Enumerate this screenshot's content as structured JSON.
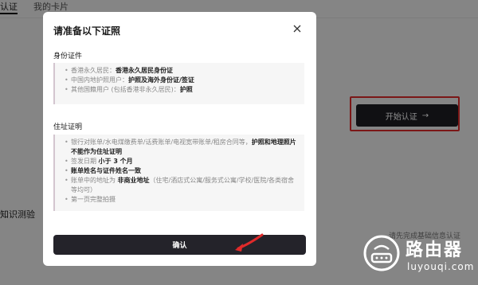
{
  "background": {
    "tabs": [
      {
        "label": "认证"
      },
      {
        "label": "我的卡片"
      }
    ],
    "start_button": {
      "label": "开始认证",
      "icon": "arrow-right-icon"
    },
    "quiz_title": "知识测验",
    "hint": "请先完成基础信息认证"
  },
  "modal": {
    "title": "请准备以下证照",
    "close_icon": "close-icon",
    "identity": {
      "title": "身份证件",
      "items": [
        {
          "label": "香港永久居民：",
          "value": "香港永久居民身份证"
        },
        {
          "label": "中国内地护照用户：",
          "value": "护照及海外身份证/签证"
        },
        {
          "label": "其他国籍用户 (包括香港非永久居民)：",
          "value": "护照"
        }
      ]
    },
    "address": {
      "title": "住址证明",
      "items": [
        {
          "label": "银行对账单/水电煤缴费单/话费账单/电视宽带账单/租房合同等，",
          "value": "护照和地理照片不能作为住址证明"
        },
        {
          "label": "签发日期",
          "value": "小于 3 个月"
        },
        {
          "label": "",
          "value": "账单姓名与证件姓名一致"
        },
        {
          "label": "账单中的地址为",
          "value": "非商业地址",
          "suffix": "（住宅/酒店式公寓/服务式公寓/学校/医院/各类宿舍等均可）"
        },
        {
          "label": "第一页完整拍摄",
          "value": ""
        }
      ]
    },
    "confirm_button": "确认"
  },
  "watermark": {
    "text": "路由器",
    "sub": "luyouqi.com"
  },
  "colors": {
    "accent_red": "#e02a2a",
    "dark_button": "#24232a"
  }
}
